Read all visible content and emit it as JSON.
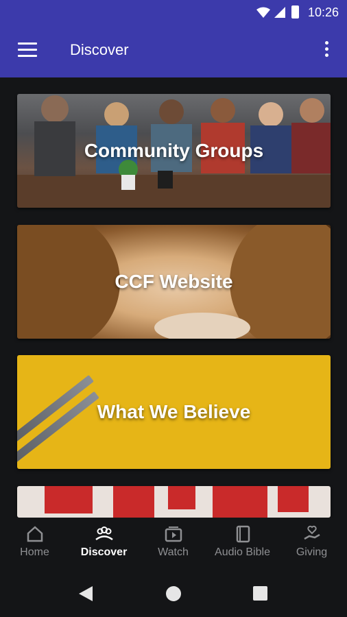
{
  "status_bar": {
    "time": "10:26"
  },
  "app_bar": {
    "title": "Discover"
  },
  "cards": [
    {
      "title": "Community Groups"
    },
    {
      "title": "CCF Website"
    },
    {
      "title": "What We Believe"
    }
  ],
  "bottom_nav": {
    "items": [
      {
        "label": "Home",
        "icon": "home-icon",
        "active": false
      },
      {
        "label": "Discover",
        "icon": "people-group-icon",
        "active": true
      },
      {
        "label": "Watch",
        "icon": "video-play-icon",
        "active": false
      },
      {
        "label": "Audio Bible",
        "icon": "book-icon",
        "active": false
      },
      {
        "label": "Giving",
        "icon": "hand-heart-icon",
        "active": false
      }
    ]
  },
  "colors": {
    "app_bar": "#3c3aab",
    "background": "#141517",
    "believe_card": "#e6b517",
    "nav_inactive": "#8f9093"
  }
}
